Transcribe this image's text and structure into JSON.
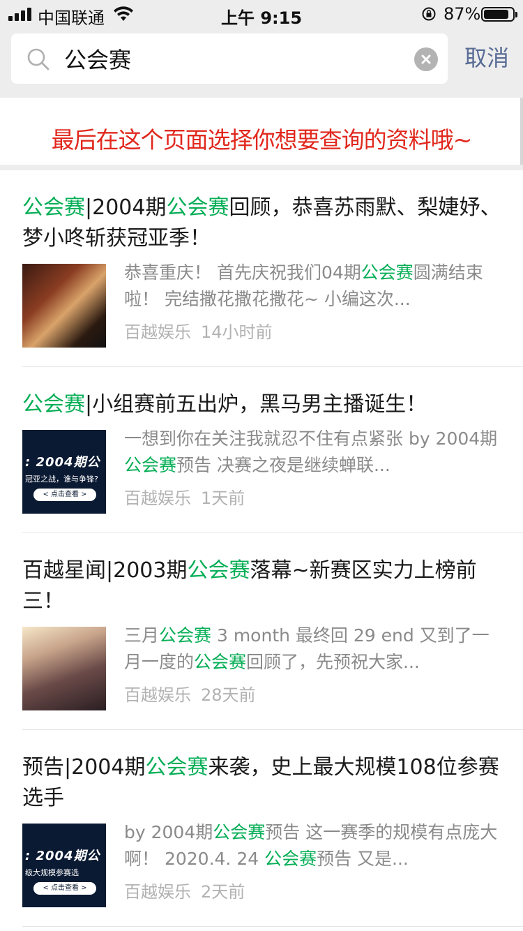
{
  "status_bar": {
    "carrier": "中国联通",
    "time": "上午 9:15",
    "battery_percent": "87%",
    "battery_level": 0.87,
    "icons": [
      "signal-icon",
      "wifi-icon",
      "orientation-lock-icon",
      "battery-icon"
    ]
  },
  "search": {
    "query": "公会赛",
    "cancel_label": "取消",
    "icons": [
      "search-icon",
      "clear-icon"
    ]
  },
  "banner": {
    "text": "最后在这个页面选择你想要查询的资料哦~",
    "color": "#e1281e"
  },
  "colors": {
    "highlight": "#06ae56",
    "link_blue": "#576b95"
  },
  "results": [
    {
      "title": [
        {
          "text": "公会赛",
          "hl": true
        },
        {
          "text": "|2004期",
          "hl": false
        },
        {
          "text": "公会赛",
          "hl": true
        },
        {
          "text": "回顾，恭喜苏雨默、梨婕妤、梦小咚斩获冠亚季！",
          "hl": false
        }
      ],
      "snippet": [
        {
          "text": "恭喜重庆！ 首先庆祝我们04期",
          "hl": false
        },
        {
          "text": "公会赛",
          "hl": true
        },
        {
          "text": "圆满结束啦！ 完结撒花撒花撒花~ 小编这次...",
          "hl": false
        }
      ],
      "source": "百越娱乐",
      "time": "14小时前"
    },
    {
      "title": [
        {
          "text": "公会赛",
          "hl": true
        },
        {
          "text": "|小组赛前五出炉，黑马男主播诞生！",
          "hl": false
        }
      ],
      "snippet": [
        {
          "text": "一想到你在关注我就忍不住有点紧张 by 2004期",
          "hl": false
        },
        {
          "text": "公会赛",
          "hl": true
        },
        {
          "text": "预告 决赛之夜是继续蝉联...",
          "hl": false
        }
      ],
      "thumb_text": {
        "title": ": 2004期公",
        "sub": "冠亚之战，谁与争锋?",
        "button": "< 点击查看 >"
      },
      "source": "百越娱乐",
      "time": "1天前"
    },
    {
      "title": [
        {
          "text": "百越星闻|2003期",
          "hl": false
        },
        {
          "text": "公会赛",
          "hl": true
        },
        {
          "text": "落幕~新赛区实力上榜前三！",
          "hl": false
        }
      ],
      "snippet": [
        {
          "text": "三月",
          "hl": false
        },
        {
          "text": "公会赛",
          "hl": true
        },
        {
          "text": " 3 month 最终回 29 end 又到了一月一度的",
          "hl": false
        },
        {
          "text": "公会赛",
          "hl": true
        },
        {
          "text": "回顾了，先预祝大家...",
          "hl": false
        }
      ],
      "source": "百越娱乐",
      "time": "28天前"
    },
    {
      "title": [
        {
          "text": "预告|2004期",
          "hl": false
        },
        {
          "text": "公会赛",
          "hl": true
        },
        {
          "text": "来袭，史上最大规模108位参赛选手",
          "hl": false
        }
      ],
      "snippet": [
        {
          "text": "by 2004期",
          "hl": false
        },
        {
          "text": "公会赛",
          "hl": true
        },
        {
          "text": "预告 这一赛季的规模有点庞大啊！ 2020.4. 24 ",
          "hl": false
        },
        {
          "text": "公会赛",
          "hl": true
        },
        {
          "text": "预告 又是...",
          "hl": false
        }
      ],
      "thumb_text": {
        "title": ": 2004期公",
        "sub": "级大规模参赛选",
        "button": "< 点击查看 >"
      },
      "source": "百越娱乐",
      "time": "2天前"
    }
  ]
}
